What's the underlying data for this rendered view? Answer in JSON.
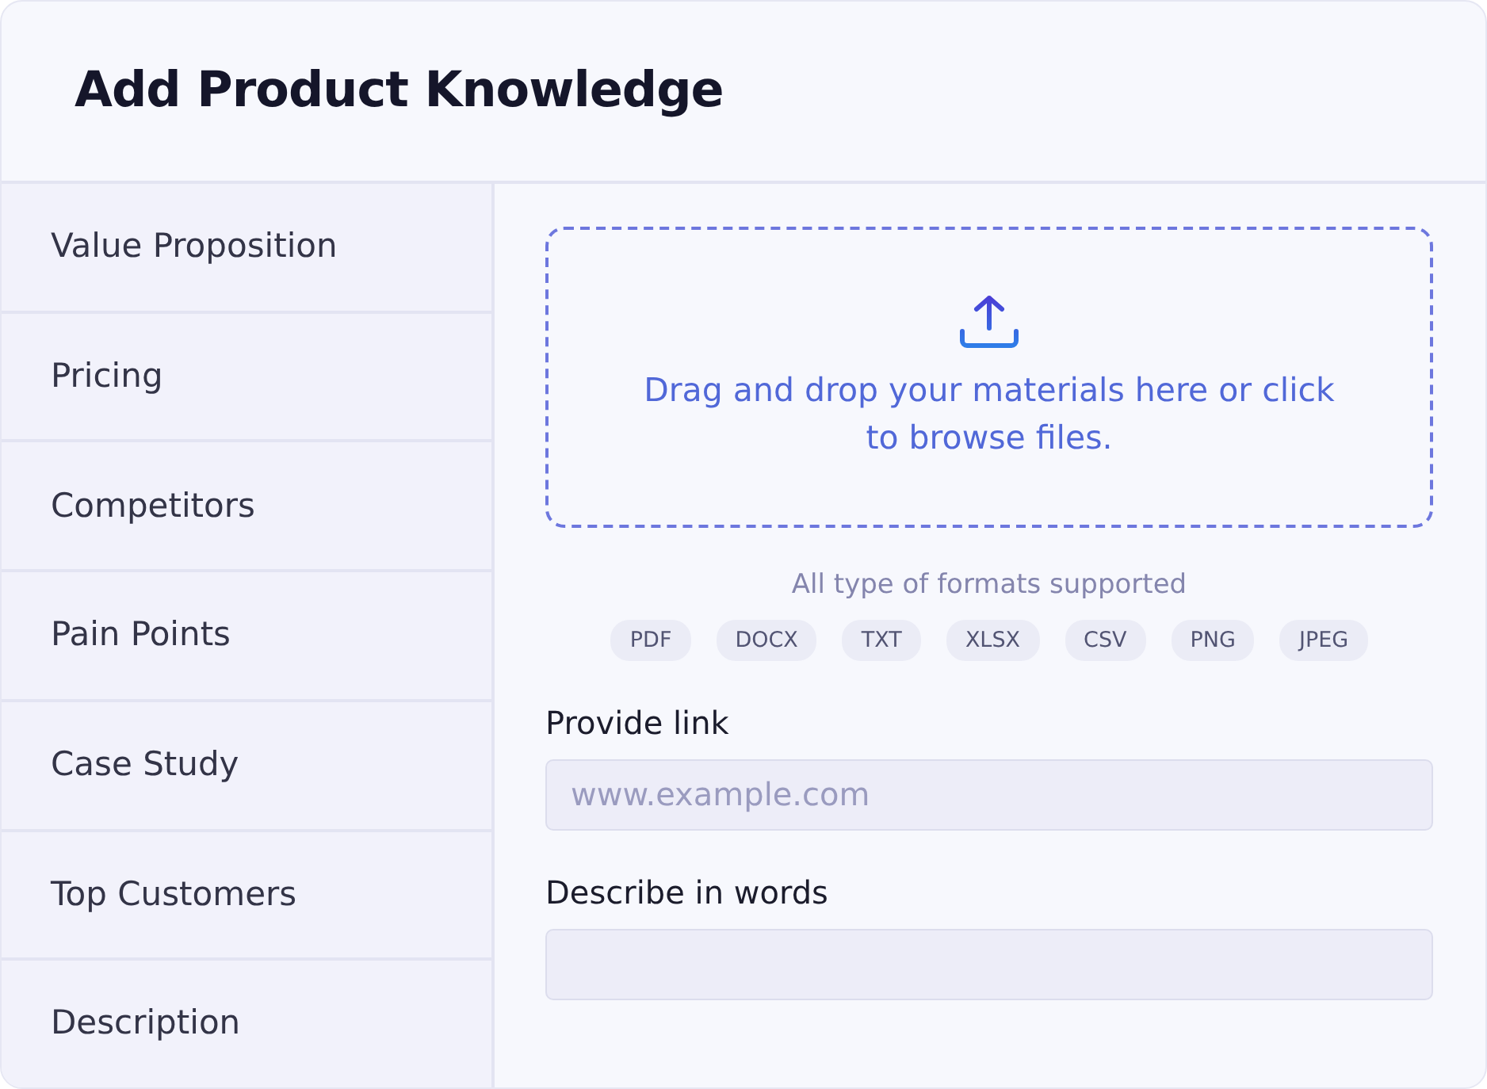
{
  "title": "Add Product Knowledge",
  "sidebar": {
    "items": [
      {
        "label": "Value Proposition"
      },
      {
        "label": "Pricing"
      },
      {
        "label": "Competitors"
      },
      {
        "label": "Pain Points"
      },
      {
        "label": "Case Study"
      },
      {
        "label": "Top Customers"
      },
      {
        "label": "Description"
      }
    ]
  },
  "upload": {
    "text": "Drag and drop your materials here or click to browse files.",
    "note": "All type of formats supported",
    "formats": [
      "PDF",
      "DOCX",
      "TXT",
      "XLSX",
      "CSV",
      "PNG",
      "JPEG"
    ]
  },
  "fields": [
    {
      "label": "Provide link",
      "placeholder": "www.example.com"
    },
    {
      "label": "Describe in words"
    }
  ]
}
